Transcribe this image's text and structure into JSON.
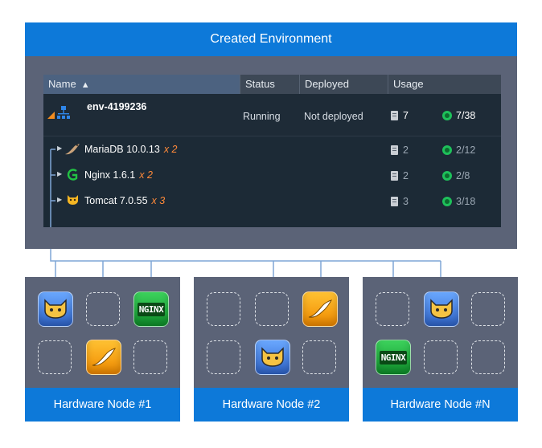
{
  "banner": {
    "title": "Created Environment"
  },
  "table": {
    "headers": {
      "name": "Name",
      "status": "Status",
      "deployed": "Deployed",
      "usage": "Usage"
    },
    "sort_arrow": "▲",
    "environment": {
      "name": "env-4199236",
      "status": "Running",
      "deployed": "Not deployed",
      "servers": "7",
      "cloudlets": "7/38"
    },
    "nodes": [
      {
        "icon": "mariadb-icon",
        "name": "MariaDB 10.0.13",
        "multiplier": "x 2",
        "servers": "2",
        "cloudlets": "2/12"
      },
      {
        "icon": "nginx-icon",
        "name": "Nginx 1.6.1",
        "multiplier": "x 2",
        "servers": "2",
        "cloudlets": "2/8"
      },
      {
        "icon": "tomcat-icon",
        "name": "Tomcat 7.0.55",
        "multiplier": "x 3",
        "servers": "3",
        "cloudlets": "3/18"
      }
    ]
  },
  "hardware_nodes": [
    {
      "label": "Hardware Node #1"
    },
    {
      "label": "Hardware Node #2"
    },
    {
      "label": "Hardware Node #N"
    }
  ],
  "app_icons": {
    "nginx": "NGINX"
  },
  "colors": {
    "banner": "#0d79d9",
    "panel": "#5b6377",
    "grid": "#1c2a36",
    "connector": "#7fa6d6",
    "multiplier": "#ff8a3a",
    "cloudlet": "#1ec05a"
  }
}
